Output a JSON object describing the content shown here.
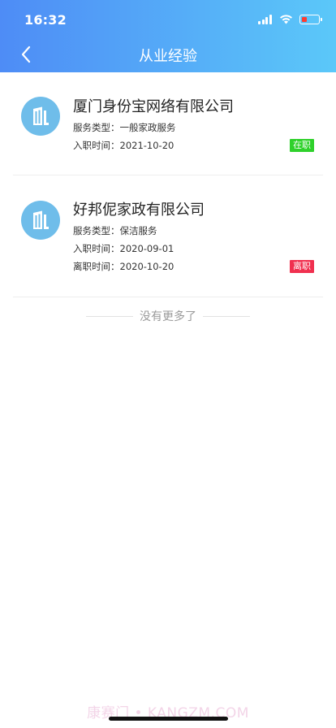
{
  "status_bar": {
    "time": "16:32"
  },
  "nav": {
    "title": "从业经验"
  },
  "experiences": [
    {
      "company": "厦门身份宝网络有限公司",
      "service_type_label": "服务类型：",
      "service_type": "一般家政服务",
      "start_label": "入职时间：",
      "start_date": "2021-10-20",
      "status": "在职",
      "status_color": "#2fd12b"
    },
    {
      "company": "好邦伲家政有限公司",
      "service_type_label": "服务类型：",
      "service_type": "保洁服务",
      "start_label": "入职时间：",
      "start_date": "2020-09-01",
      "end_label": "离职时间：",
      "end_date": "2020-10-20",
      "status": "离职",
      "status_color": "#f0304f"
    }
  ],
  "footer": {
    "no_more": "没有更多了"
  },
  "watermark": "康赛门 • KANGZM.COM",
  "colors": {
    "header_start": "#4e8cf6",
    "header_end": "#5bc8f9",
    "icon_bg": "#6fbdea"
  }
}
